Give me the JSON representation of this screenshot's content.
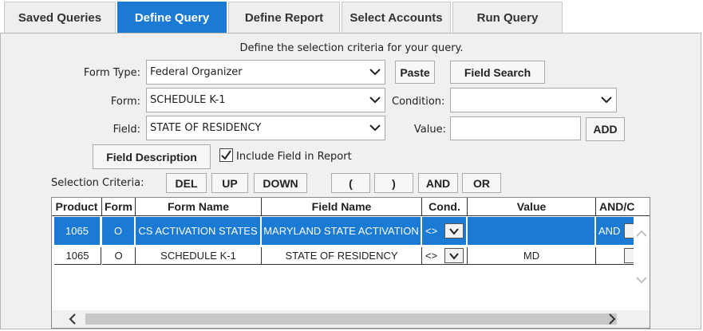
{
  "tabs": [
    {
      "label": "Saved Queries",
      "active": false
    },
    {
      "label": "Define Query",
      "active": true
    },
    {
      "label": "Define Report",
      "active": false
    },
    {
      "label": "Select Accounts",
      "active": false
    },
    {
      "label": "Run Query",
      "active": false
    }
  ],
  "intro": "Define the selection criteria for your query.",
  "form": {
    "form_type_label": "Form Type:",
    "form_type_value": "Federal Organizer",
    "form_label": "Form:",
    "form_value": "SCHEDULE K-1",
    "field_label": "Field:",
    "field_value": "STATE OF RESIDENCY",
    "condition_label": "Condition:",
    "condition_value": "",
    "value_label": "Value:",
    "value_value": "",
    "paste_label": "Paste",
    "field_search_label": "Field Search",
    "add_label": "ADD",
    "field_description_label": "Field Description",
    "include_label": "Include Field in Report",
    "include_checked": true
  },
  "criteria": {
    "label": "Selection Criteria:",
    "buttons": [
      "DEL",
      "UP",
      "DOWN",
      "(",
      ")",
      "AND",
      "OR"
    ]
  },
  "table": {
    "headers": [
      "Product",
      "Form",
      "Form Name",
      "Field Name",
      "Cond.",
      "Value",
      "AND/C"
    ],
    "rows": [
      {
        "product": "1065",
        "form": "O",
        "form_name": "CS ACTIVATION STATES",
        "field_name": "MARYLAND STATE ACTIVATION",
        "cond": "<>",
        "value": "",
        "andor": "AND",
        "selected": true
      },
      {
        "product": "1065",
        "form": "O",
        "form_name": "SCHEDULE K-1",
        "field_name": "STATE OF RESIDENCY",
        "cond": "<>",
        "value": "MD",
        "andor": "",
        "selected": false
      }
    ]
  },
  "colors": {
    "accent": "#1a7ad4",
    "panel": "#f0f0f0"
  },
  "icons": [
    "chevron-down-icon",
    "check-icon",
    "scroll-up-icon",
    "scroll-down-icon",
    "scroll-left-icon",
    "scroll-right-icon"
  ]
}
